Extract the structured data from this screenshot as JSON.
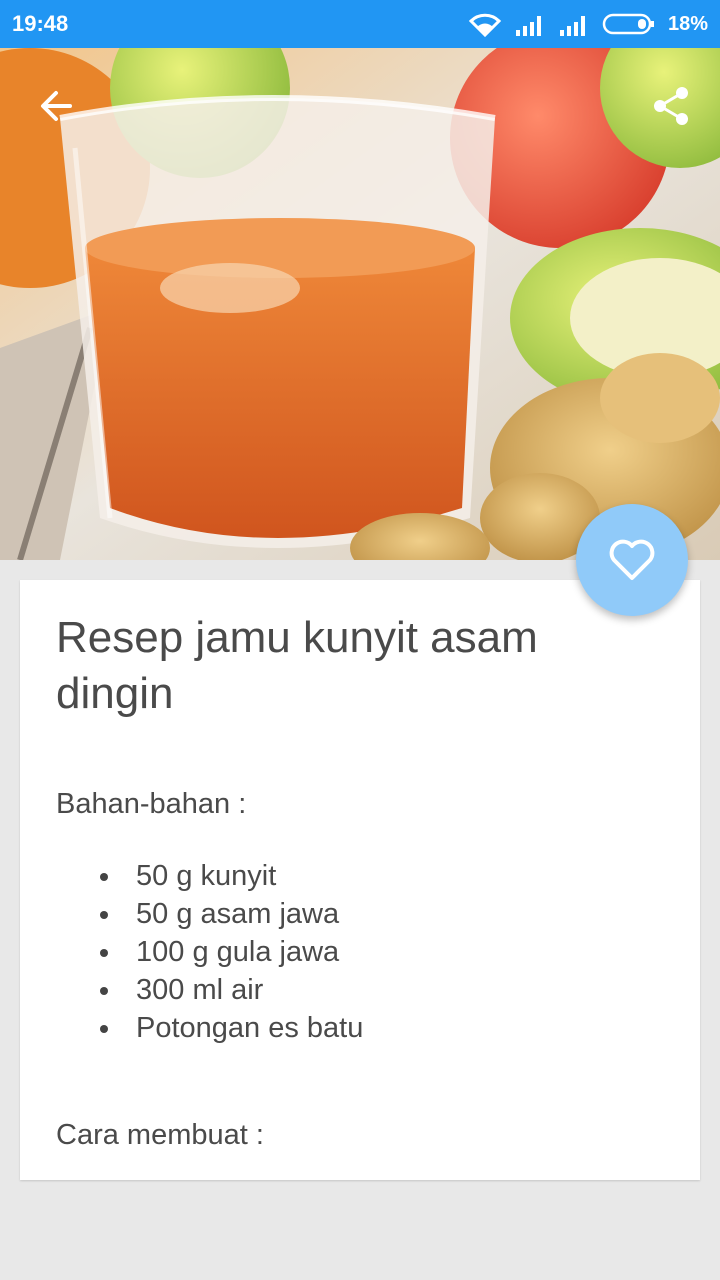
{
  "status_bar": {
    "time": "19:48",
    "battery_percent": "18%",
    "icons": [
      "wifi-icon",
      "signal-icon",
      "signal-icon",
      "battery-icon"
    ],
    "color": "#2196f3"
  },
  "app_bar": {
    "back_icon": "arrow-left-icon",
    "share_icon": "share-icon"
  },
  "fab": {
    "icon": "heart-outline-icon",
    "color": "#90caf9"
  },
  "recipe": {
    "title": "Resep jamu kunyit asam dingin",
    "ingredients_label": "Bahan-bahan :",
    "ingredients": [
      "50 g kunyit",
      "50 g asam jawa",
      "100 g gula jawa",
      "300 ml air",
      "Potongan es batu"
    ],
    "method_label": "Cara membuat :"
  }
}
